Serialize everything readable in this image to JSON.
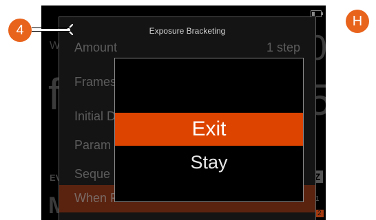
{
  "header": {
    "title": "Exposure Bracketing",
    "back_icon": "chevron-left-icon"
  },
  "menu": {
    "items": [
      {
        "label": "Amount",
        "value": "1 step"
      },
      {
        "label": "Frames",
        "value": ""
      },
      {
        "label": "Initial D",
        "value": ""
      },
      {
        "label": "Param",
        "value": ""
      },
      {
        "label": "Seque",
        "value": ""
      },
      {
        "label": "When Finished",
        "value": "Exit",
        "selected": true
      }
    ]
  },
  "dialog": {
    "options": [
      {
        "label": "Exit",
        "selected": true
      },
      {
        "label": "Stay",
        "selected": false
      }
    ]
  },
  "background": {
    "w": "W",
    "zero": "0",
    "f": "f",
    "five": "5",
    "ev": "EV",
    "z": "Z",
    "m": "M",
    "one": "1",
    "two": "2"
  },
  "annotations": {
    "badge_4": "4",
    "badge_h": "H"
  },
  "colors": {
    "accent": "#dd4400",
    "badge": "#e8631c",
    "selected_row": "#5a2310"
  }
}
